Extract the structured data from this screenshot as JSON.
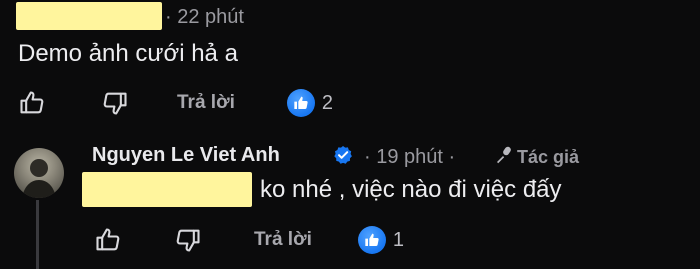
{
  "comment1": {
    "time": "· 22 phút",
    "text": "Demo ảnh cưới hả a",
    "reply_label": "Trả lời",
    "reaction_count": "2",
    "reaction_icon": "like-icon",
    "redact_color": "#fff59d"
  },
  "comment2": {
    "author": "Nguyen Le Viet Anh",
    "time": "· 19 phút ·",
    "author_tag": "Tác giả",
    "text": "ko nhé , việc nào đi việc đấy",
    "reply_label": "Trả lời",
    "reaction_count": "1",
    "reaction_icon": "like-icon"
  },
  "colors": {
    "background": "#0b0b0c",
    "accent": "#1877f2",
    "redaction": "#fff59d"
  }
}
